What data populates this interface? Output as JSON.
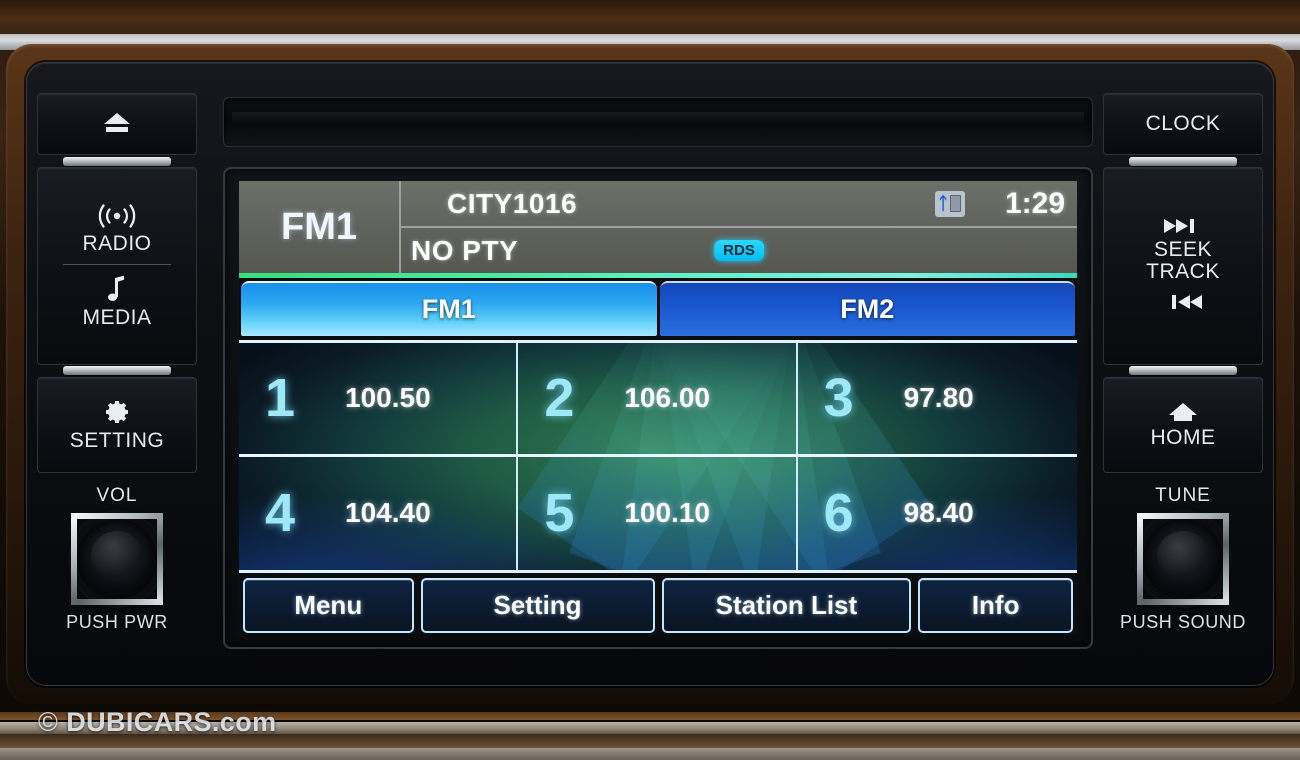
{
  "device": {
    "cd_slot": "cd-slot"
  },
  "left_panel": {
    "eject": {
      "icon": "eject-icon",
      "label": ""
    },
    "radio": {
      "icon": "radio-waves-icon",
      "label": "RADIO"
    },
    "media": {
      "icon": "music-note-icon",
      "label": "MEDIA"
    },
    "setting": {
      "icon": "gear-icon",
      "label": "SETTING"
    },
    "volume": {
      "title": "VOL",
      "sub": "PUSH PWR"
    }
  },
  "right_panel": {
    "clock": {
      "label": "CLOCK"
    },
    "seek": {
      "label_line1": "SEEK",
      "label_line2": "TRACK",
      "next_icon": "next-track-icon",
      "prev_icon": "previous-track-icon"
    },
    "home": {
      "icon": "home-icon",
      "label": "HOME"
    },
    "tune": {
      "title": "TUNE",
      "sub": "PUSH SOUND"
    }
  },
  "screen": {
    "header": {
      "band": "FM1",
      "station_name": "CITY1016",
      "program_type": "NO PTY",
      "rds_badge": "RDS",
      "bluetooth_icon": "bluetooth-icon",
      "clock": "1:29"
    },
    "tabs": [
      {
        "label": "FM1",
        "active": true
      },
      {
        "label": "FM2",
        "active": false
      }
    ],
    "presets": [
      {
        "number": "1",
        "frequency": "100.50"
      },
      {
        "number": "2",
        "frequency": "106.00"
      },
      {
        "number": "3",
        "frequency": "97.80"
      },
      {
        "number": "4",
        "frequency": "104.40"
      },
      {
        "number": "5",
        "frequency": "100.10"
      },
      {
        "number": "6",
        "frequency": "98.40"
      }
    ],
    "softkeys": [
      {
        "label": "Menu"
      },
      {
        "label": "Setting"
      },
      {
        "label": "Station List"
      },
      {
        "label": "Info"
      }
    ]
  },
  "watermark": {
    "copyright": "©",
    "text": "DUBICARS.com"
  },
  "colors": {
    "tab_active": "#2ba7f2",
    "tab_inactive": "#1a58cf",
    "rds": "#00bdf2",
    "preset_number": "#9fe8f7",
    "header_bar": "#5f615c",
    "accent_underline": "#46e89a"
  }
}
